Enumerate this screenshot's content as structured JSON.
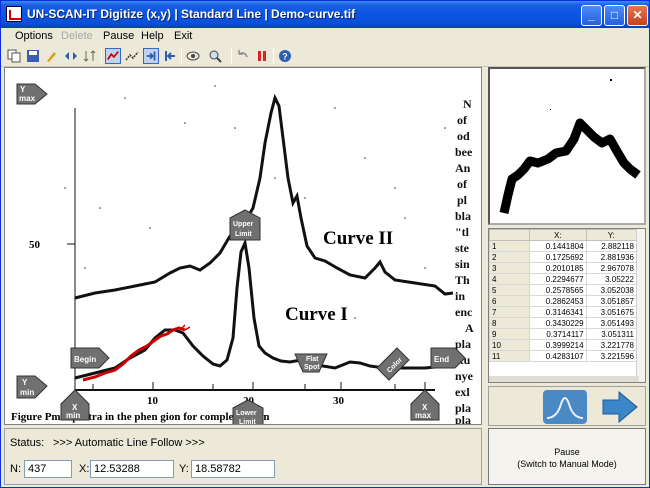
{
  "window": {
    "title": "UN-SCAN-IT Digitize (x,y) | Standard Line | Demo-curve.tif",
    "buttons": [
      "minimize",
      "maximize",
      "close"
    ]
  },
  "menu": {
    "items": [
      {
        "label": "Options",
        "enabled": true
      },
      {
        "label": "Delete",
        "enabled": false
      },
      {
        "label": "Pause",
        "enabled": true
      },
      {
        "label": "Help",
        "enabled": true
      },
      {
        "label": "Exit",
        "enabled": true
      }
    ]
  },
  "toolbar": {
    "icons": [
      "copy-icon",
      "save-icon",
      "brush-icon",
      "swap-icon",
      "sort-icon",
      "auto-line-icon",
      "manual-line-icon",
      "point-right-icon",
      "point-left-icon",
      "view-icon",
      "zoom-icon",
      "undo-icon",
      "pause-icon",
      "help-icon"
    ]
  },
  "canvas": {
    "markers": {
      "y_max": "Y max",
      "y_min": "Y min",
      "x_min": "X min",
      "x_max": "X max",
      "begin": "Begin",
      "end": "End",
      "upper_limit": "Upper Limit",
      "lower_limit": "Lower Limit",
      "flat_spot": "Flat Spot",
      "color": "Color"
    },
    "image_text": {
      "curve_ii": "Curve II",
      "curve_i": "Curve I",
      "y_tick_50": "50",
      "x_ticks": [
        "10",
        "20",
        "30"
      ],
      "caption": "Figure    Pmr spectra in the phen   gion for complexes I an",
      "right_column": [
        "N",
        "of",
        "od",
        "bee",
        "An",
        "of",
        "pl",
        "bla",
        "\"tl",
        "ste",
        "sin",
        "Th",
        "in",
        "enc",
        "A",
        "pla",
        "stu",
        "nye",
        "exl",
        "pla",
        "pla",
        "TV"
      ]
    }
  },
  "table": {
    "headers": [
      "",
      "X:",
      "Y:"
    ],
    "rows": [
      [
        "1",
        "0.1441804",
        "2.882118"
      ],
      [
        "2",
        "0.1725692",
        "2.881936"
      ],
      [
        "3",
        "0.2010185",
        "2.967078"
      ],
      [
        "4",
        "0.2294677",
        "3.05222"
      ],
      [
        "5",
        "0.2578565",
        "3.052038"
      ],
      [
        "6",
        "0.2862453",
        "3.051857"
      ],
      [
        "7",
        "0.3146341",
        "3.051675"
      ],
      [
        "8",
        "0.3430229",
        "3.051493"
      ],
      [
        "9",
        "0.3714117",
        "3.051311"
      ],
      [
        "10",
        "0.3999214",
        "3.221778"
      ],
      [
        "11",
        "0.4283107",
        "3.221596"
      ]
    ]
  },
  "status": {
    "label": "Status:",
    "text": ">>> Automatic Line Follow >>>",
    "n_label": "N:",
    "n_value": "437",
    "x_label": "X:",
    "x_value": "12.53288",
    "y_label": "Y:",
    "y_value": "18.58782"
  },
  "pause_button": {
    "line1": "Pause",
    "line2": "(Switch to Manual Mode)"
  },
  "colors": {
    "title_bar": "#0b55e4",
    "digitized_curve": "#cc0000",
    "marker_gray": "#808080",
    "nav_arrow": "#3a86c8"
  }
}
